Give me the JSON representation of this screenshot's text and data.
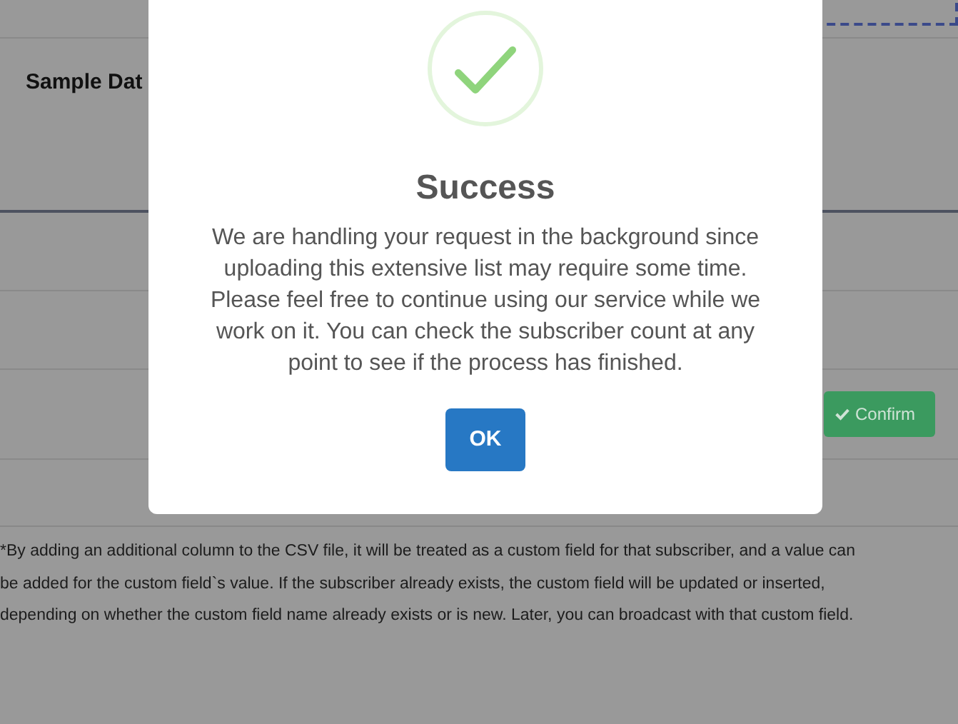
{
  "page": {
    "card_title": "Sample Dat",
    "confirm_button": "Confirm",
    "note_lines": [
      "*By adding an additional column to the CSV file, it will be treated as a custom field for that subscriber, and a value can",
      "be added for the custom field`s value. If the subscriber already exists, the custom field will be updated or inserted,",
      "depending on whether the custom field name already exists or is new. Later, you can broadcast with that custom field."
    ]
  },
  "dialog": {
    "title": "Success",
    "message": "We are handling your request in the background since uploading this extensive list may require some time. Please feel free to continue using our service while we work on it. You can check the subscriber count at any point to see if the process has finished.",
    "button": "OK"
  }
}
